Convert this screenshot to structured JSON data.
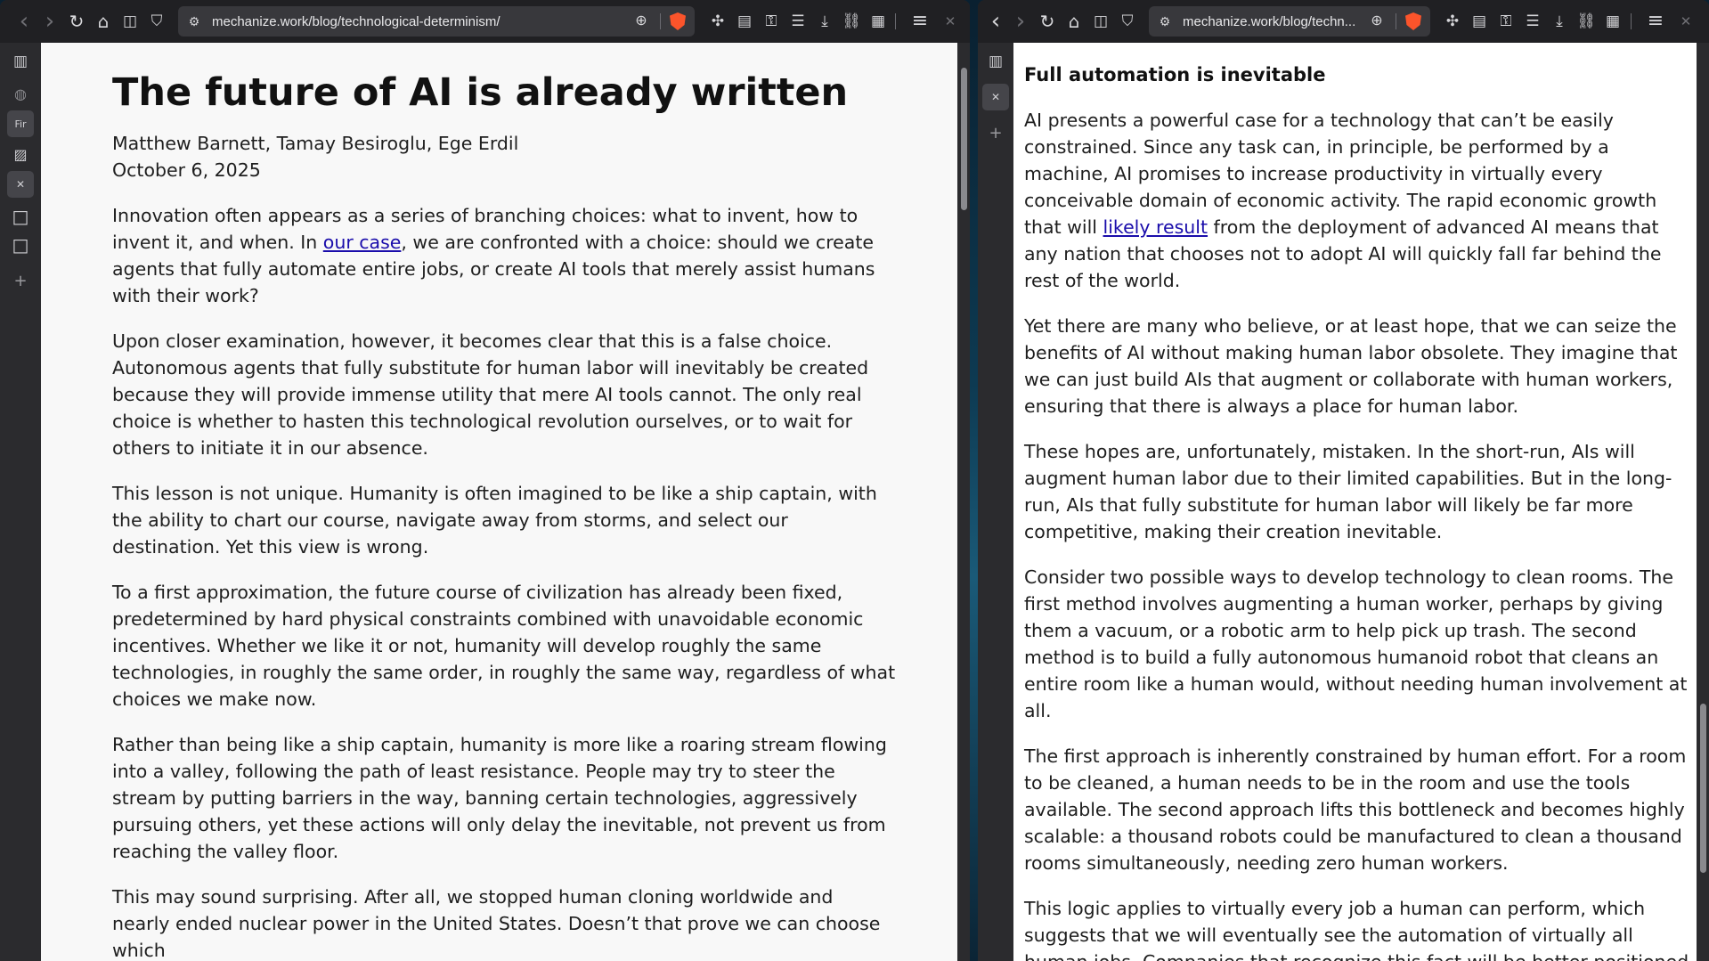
{
  "left_window": {
    "url": "mechanize.work/blog/technological-determinism/",
    "article": {
      "title": "The future of AI is already written",
      "authors": "Matthew Barnett, Tamay Besiroglu, Ege Erdil",
      "date": "October 6, 2025",
      "p1_before": "Innovation often appears as a series of branching choices: what to invent, how to invent it, and when. In ",
      "p1_link": "our case",
      "p1_after": ", we are confronted with a choice: should we create agents that fully automate entire jobs, or create AI tools that merely assist humans with their work?",
      "p2": "Upon closer examination, however, it becomes clear that this is a false choice. Autonomous agents that fully substitute for human labor will inevitably be created because they will provide immense utility that mere AI tools cannot. The only real choice is whether to hasten this technological revolution ourselves, or to wait for others to initiate it in our absence.",
      "p3": "This lesson is not unique. Humanity is often imagined to be like a ship captain, with the ability to chart our course, navigate away from storms, and select our destination. Yet this view is wrong.",
      "p4": "To a first approximation, the future course of civilization has already been fixed, predetermined by hard physical constraints combined with unavoidable economic incentives. Whether we like it or not, humanity will develop roughly the same technologies, in roughly the same order, in roughly the same way, regardless of what choices we make now.",
      "p5": "Rather than being like a ship captain, humanity is more like a roaring stream flowing into a valley, following the path of least resistance. People may try to steer the stream by putting barriers in the way, banning certain technologies, aggressively pursuing others, yet these actions will only delay the inevitable, not prevent us from reaching the valley floor.",
      "p6": "This may sound surprising. After all, we stopped human cloning worldwide and nearly ended nuclear power in the United States. Doesn’t that prove we can choose which"
    },
    "sidebar": {
      "tab_short_label": "Fir"
    }
  },
  "right_window": {
    "url": "mechanize.work/blog/techn...",
    "article": {
      "heading": "Full automation is inevitable",
      "p1_before": "AI presents a powerful case for a technology that can’t be easily constrained. Since any task can, in principle, be performed by a machine, AI promises to increase productivity in virtually every conceivable domain of economic activity. The rapid economic growth that will ",
      "p1_link": "likely result",
      "p1_after": " from the deployment of advanced AI means that any nation that chooses not to adopt AI will quickly fall far behind the rest of the world.",
      "p2": "Yet there are many who believe, or at least hope, that we can seize the benefits of AI without making human labor obsolete. They imagine that we can just build AIs that augment or collaborate with human workers, ensuring that there is always a place for human labor.",
      "p3": "These hopes are, unfortunately, mistaken. In the short-run, AIs will augment human labor due to their limited capabilities. But in the long-run, AIs that fully substitute for human labor will likely be far more competitive, making their creation inevitable.",
      "p4": "Consider two possible ways to develop technology to clean rooms. The first method involves augmenting a human worker, perhaps by giving them a vacuum, or a robotic arm to help pick up trash. The second method is to build a fully autonomous humanoid robot that cleans an entire room like a human would, without needing human involvement at all.",
      "p5": "The first approach is inherently constrained by human effort. For a room to be cleaned, a human needs to be in the room and use the tools available. The second approach lifts this bottleneck and becomes highly scalable: a thousand robots could be manufactured to clean a thousand rooms simultaneously, needing zero human workers.",
      "p6": "This logic applies to virtually every job a human can perform, which suggests that we will eventually see the automation of virtually all human jobs. Companies that recognize this fact will be better positioned"
    }
  },
  "icons": {
    "back": "‹",
    "forward": "›",
    "reload": "↻",
    "home": "⌂",
    "split": "◫",
    "bookmark": "⛉",
    "site_info": "⚙",
    "zoom": "⊕",
    "extensions": "✣",
    "reader": "▤",
    "key": "⚿",
    "reading_list": "☰",
    "download": "⤓",
    "link": "⛓",
    "qr": "▦",
    "menu": "≡",
    "close": "✕",
    "sidebar_toggle": "▥",
    "globe": "◍",
    "image": "▨",
    "square": "□",
    "plus": "+"
  },
  "colors": {
    "brave_shield": "#fb542b",
    "link": "#1a0dab"
  }
}
